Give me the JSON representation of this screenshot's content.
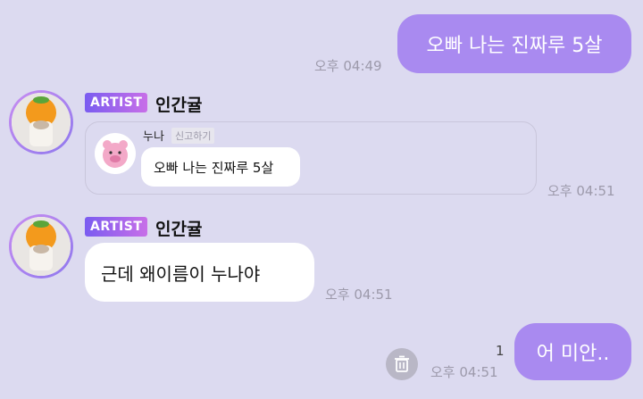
{
  "messages": {
    "m1": {
      "text": "오빠 나는 진짜루 5살",
      "time": "오후 04:49"
    },
    "m2": {
      "badge": "ARTIST",
      "sender": "인간귤",
      "quote_sender": "누나",
      "report_label": "신고하기",
      "quote_text": "오빠 나는 진짜루 5살",
      "time": "오후 04:51"
    },
    "m3": {
      "badge": "ARTIST",
      "sender": "인간귤",
      "text": "근데 왜이름이 누나야",
      "time": "오후 04:51"
    },
    "m4": {
      "text": "어 미안..",
      "time": "오후 04:51",
      "unread_count": "1"
    }
  },
  "colors": {
    "background": "#dcdaf0",
    "outgoing_bubble": "#a98af0",
    "incoming_bubble": "#ffffff",
    "badge_gradient": [
      "#7a5cf0",
      "#c86fe8"
    ]
  },
  "icons": [
    "orange-hat-avatar-icon",
    "pink-pig-avatar-icon",
    "trash-icon"
  ]
}
